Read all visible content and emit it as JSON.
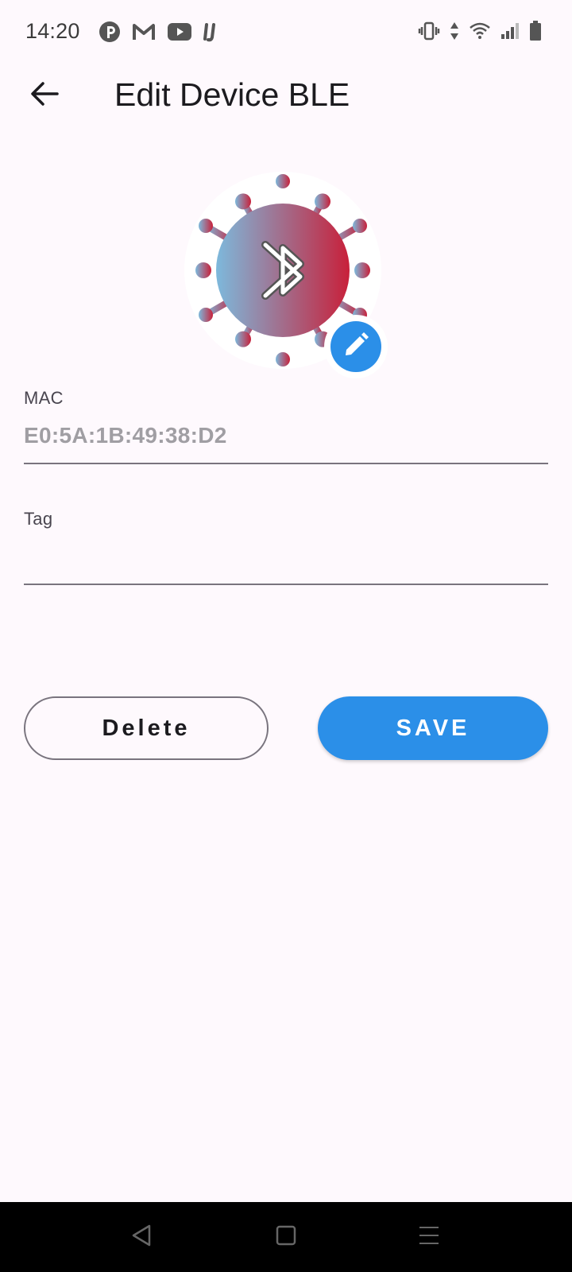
{
  "status_bar": {
    "time": "14:20",
    "left_icons": [
      "pinterest-icon",
      "gmail-icon",
      "youtube-icon",
      "intellij-icon"
    ],
    "right_icons": [
      "vibrate-icon",
      "data-arrows-icon",
      "wifi-icon",
      "signal-icon",
      "battery-icon"
    ]
  },
  "app_bar": {
    "back_icon": "arrow-left-icon",
    "title": "Edit Device BLE"
  },
  "avatar": {
    "image": "virus-bluetooth-logo",
    "edit_icon": "pencil-icon",
    "gradient_left": "#7db9dc",
    "gradient_right": "#c8203a",
    "edit_badge_color": "#2b8fe8"
  },
  "form": {
    "mac": {
      "label": "MAC",
      "value": "E0:5A:1B:49:38:D2"
    },
    "tag": {
      "label": "Tag",
      "value": ""
    }
  },
  "actions": {
    "delete_label": "Delete",
    "save_label": "SAVE",
    "save_color": "#2b8fe8"
  },
  "nav_bar": {
    "icons": [
      "nav-back-icon",
      "nav-home-icon",
      "nav-menu-icon"
    ]
  }
}
